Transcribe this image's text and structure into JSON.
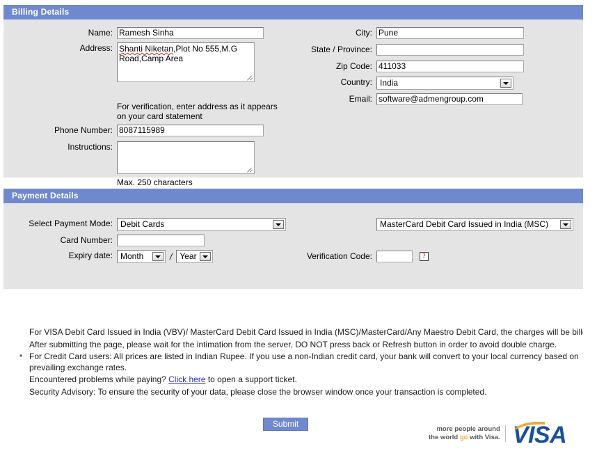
{
  "billing": {
    "header": "Billing Details",
    "name": {
      "label": "Name:",
      "value": "Ramesh Sinha"
    },
    "address": {
      "label": "Address:",
      "value_line1_spell": "Shanti Niketan",
      "value_line1_rest": ",Plot No 555,M.G",
      "value_line2": "Road,Camp Area",
      "hint_line1": "For verification, enter address as it appears",
      "hint_line2": "on your card statement"
    },
    "phone": {
      "label": "Phone Number:",
      "value": "8087115989"
    },
    "instructions": {
      "label": "Instructions:",
      "value": "",
      "hint": "Max. 250 characters"
    },
    "city": {
      "label": "City:",
      "value": "Pune"
    },
    "state": {
      "label": "State / Province:",
      "value": ""
    },
    "zip": {
      "label": "Zip Code:",
      "value": "411033"
    },
    "country": {
      "label": "Country:",
      "value": "India"
    },
    "email": {
      "label": "Email:",
      "value": "software@admengroup.com"
    }
  },
  "payment": {
    "header": "Payment Details",
    "mode": {
      "label": "Select Payment Mode:",
      "value": "Debit Cards"
    },
    "card_issuer": {
      "value": "MasterCard Debit Card Issued in India (MSC)"
    },
    "card_number": {
      "label": "Card Number:",
      "value": ""
    },
    "expiry": {
      "label": "Expiry date:",
      "month_value": "Month",
      "separator": "/",
      "year_value": "Year"
    },
    "verification": {
      "label": "Verification Code:",
      "value": "",
      "help_icon": "question-mark-placeholder-icon",
      "help_glyph": "?"
    }
  },
  "notes": [
    {
      "text": "For VISA Debit Card Issued in India (VBV)/ MasterCard Debit Card Issued in India (MSC)/MasterCard/Any Maestro Debit Card, the charges will be billed to your credit",
      "nowrap": true
    },
    {
      "text": "After submitting the page, please wait for the intimation from the server, DO NOT press back or Refresh button in order to avoid double charge.",
      "nowrap": true
    },
    {
      "text": "For Credit Card users: All prices are listed in Indian Rupee. If you use a non-Indian credit card, your bank will convert to your local currency based on prevailing exchange rates.",
      "nowrap": false
    },
    {
      "text_before": "Encountered problems while paying? ",
      "link": "Click here",
      "text_after": " to open a support ticket.",
      "nowrap": true
    },
    {
      "text": "Security Advisory: To ensure the security of your data, please close the browser window once your transaction is completed.",
      "nowrap": true
    }
  ],
  "footer": {
    "submit_label": "Submit",
    "visa_tagline_line1": "more people around",
    "visa_tagline_line2_before": "the world ",
    "visa_tagline_go": "go",
    "visa_tagline_line2_after": " with Visa.",
    "visa_wordmark": "VISA"
  },
  "colors": {
    "header_blue": "#7089ce",
    "panel_bg": "#e4e4e4",
    "link_blue": "#2b32c4",
    "visa_blue": "#1a4f9c",
    "visa_gold": "#f2a93b"
  }
}
